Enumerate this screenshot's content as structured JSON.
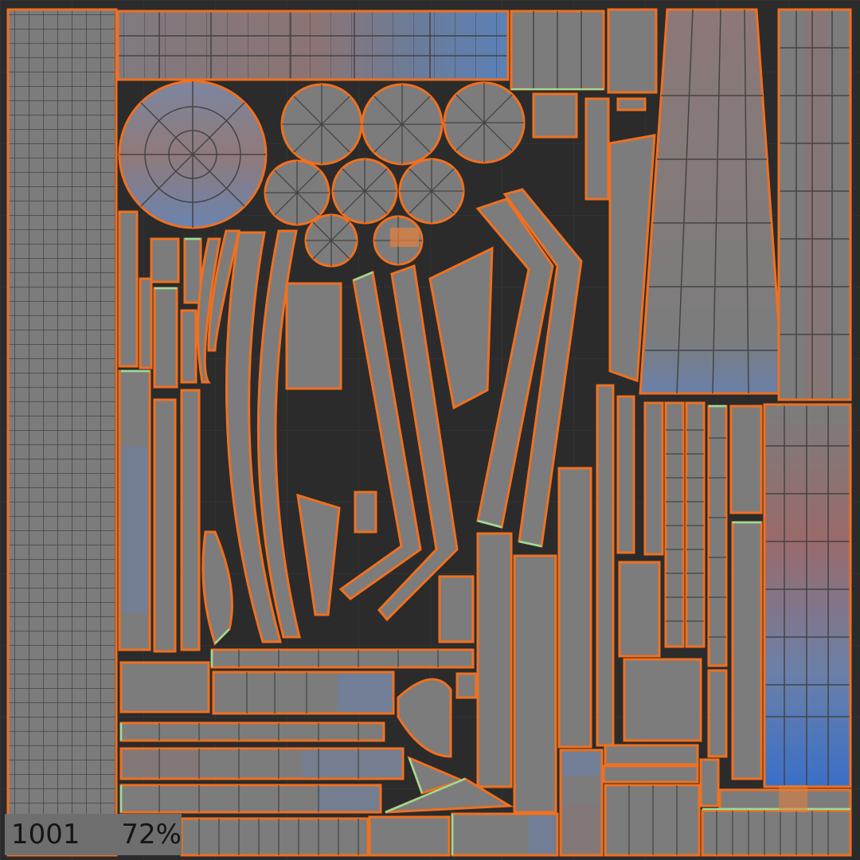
{
  "viewer": {
    "udim_tile": "1001",
    "zoom": "72%"
  },
  "colors": {
    "background": "#2b2b2b",
    "uv_fill": "#7c7c7c",
    "uv_edge": "#3f3f3f",
    "seam_selected": "#f07020",
    "seam_open": "#8fe0a0",
    "stretch_compress": "#5b7fb0",
    "stretch_expand": "#a06e6e",
    "stretch_high": "#3a6fc8",
    "status_bg": "#6e6e6e"
  }
}
